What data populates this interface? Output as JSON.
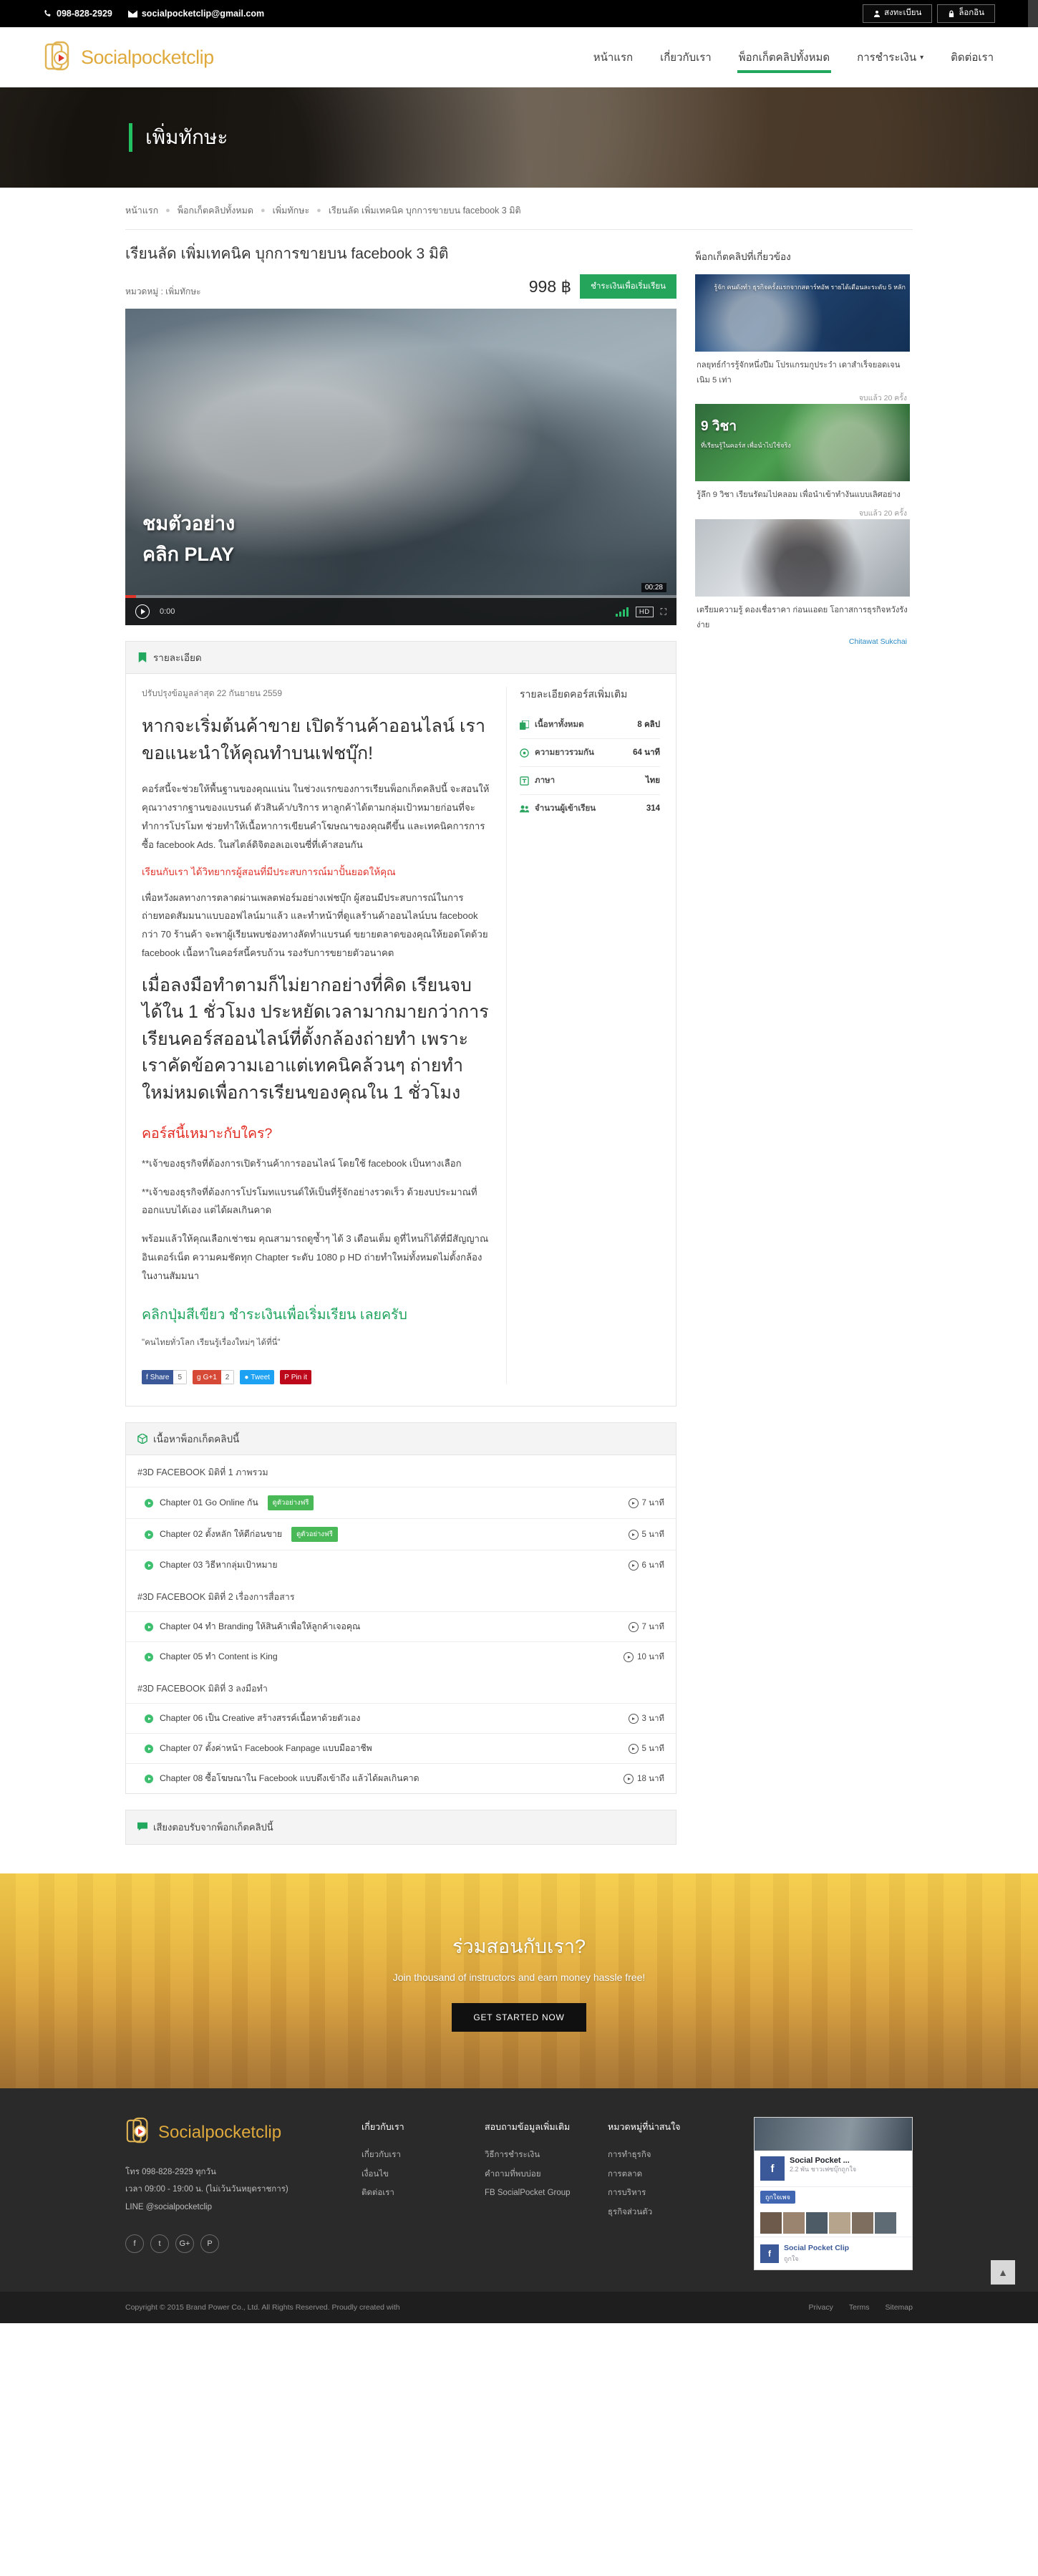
{
  "topbar": {
    "phone": "098-828-2929",
    "email": "socialpocketclip@gmail.com",
    "register_label": "สงทะเบียน",
    "login_label": "ล็อกอิน"
  },
  "brand": {
    "name": "Socialpocketclip",
    "color": "#dfa93c"
  },
  "nav": {
    "items": [
      {
        "label": "หน้าแรก",
        "active": false,
        "caret": false
      },
      {
        "label": "เกี่ยวกับเรา",
        "active": false,
        "caret": false
      },
      {
        "label": "พ็อกเก็ตคลิปทั้งหมด",
        "active": true,
        "caret": false
      },
      {
        "label": "การชำระเงิน",
        "active": false,
        "caret": true
      },
      {
        "label": "ติดต่อเรา",
        "active": false,
        "caret": false
      }
    ]
  },
  "hero": {
    "title": "เพิ่มทักษะ",
    "accent": "#22c061"
  },
  "breadcrumb": [
    "หน้าแรก",
    "พ็อกเก็ตคลิปทั้งหมด",
    "เพิ่มทักษะ",
    "เรียนลัด เพิ่มเทคนิค บุกการขายบน facebook 3 มิติ"
  ],
  "course": {
    "title": "เรียนลัด เพิ่มเทคนิค บุกการขายบน facebook 3 มิติ",
    "category_label": "หมวดหมู่ : เพิ่มทักษะ",
    "price": "998 ฿",
    "buy_label": "ชำระเงินเพื่อเริ่มเรียน"
  },
  "video": {
    "caption_line1": "ชมตัวอย่าง",
    "caption_line2": "คลิก PLAY",
    "time_bubble": "00:28",
    "current_time": "0:00",
    "hd_label": "HD"
  },
  "detail_panel": {
    "head": "รายละเอียด",
    "head_icon": "bookmark-icon",
    "updated": "ปรับปรุงข้อมูลล่าสุด 22 กันยายน 2559",
    "heading1": "หากจะเริ่มต้นค้าขาย เปิดร้านค้าออนไลน์ เราขอแนะนำให้คุณทำบนเฟชบุ๊ก!",
    "para1": "คอร์สนี้จะช่วยให้พื้นฐานของคุณแน่น  ในช่วงแรกของการเรียนพ็อกเก็ตคลิปนี้ จะสอนให้คุณวางรากฐานของแบรนด์ ตัวสินค้า/บริการ หาลูกค้าได้ตามกลุ่มเป้าหมายก่อนที่จะทำการโปรโมท ช่วยทำให้เนื้อหาการเขียนคำโฆษณาของคุณดีขึ้น และเทคนิคการการซื้อ facebook Ads. ในสไตล์ดิจิตอลเอเจนซี่ที่เค้าสอนกัน",
    "red_line": "เรียนกับเรา ได้วิทยากรผู้สอนที่มีประสบการณ์มาปั้นยอดให้คุณ",
    "para2": "เพื่อหวังผลทางการตลาดผ่านเพลตฟอร์มอย่างเฟชบุ๊ก ผู้สอนมีประสบการณ์ในการถ่ายทอดสัมมนาแบบออฟไลน์มาแล้ว  และทำหน้าที่ดูแลร้านค้าออนไลน์บน facebook กว่า 70 ร้านค้า จะพาผู้เรียนพบช่องทางลัดทำแบรนด์ ขยายตลาดของคุณให้ยอดโตด้วย facebook เนื้อหาในคอร์สนี้ครบถ้วน รองรับการขยายตัวอนาคต",
    "heading2": "เมื่อลงมือทำตามก็ไม่ยากอย่างที่คิด เรียนจบได้ใน 1 ชั่วโมง ประหยัดเวลามากมายกว่าการเรียนคอร์สออนไลน์ที่ตั้งกล้องถ่ายทำ เพราะเราคัดข้อความเอาแต่เทคนิคล้วนๆ ถ่ายทำใหม่หมดเพื่อการเรียนของคุณใน 1 ชั่วโมง",
    "who_heading": "คอร์สนี้เหมาะกับใคร?",
    "who1": "**เจ้าของธุรกิจที่ต้องการเปิดร้านค้าการออนไลน์ โดยใช้ facebook เป็นทางเลือก",
    "who2": "**เจ้าของธุรกิจที่ต้องการโปรโมทแบรนด์ให้เป็นที่รู้จักอย่างรวดเร็ว ด้วยงบประมาณที่ออกแบบได้เอง แต่ได้ผลเกินคาด",
    "who3": "พร้อมแล้วให้คุณเลือกเช่าชม  คุณสามารถดูซ้ำๆ ได้ 3 เดือนเต็ม ดูที่ไหนก็ได้ที่มีสัญญาณอินเตอร์เน็ต ความคมชัดทุก Chapter ระดับ 1080 p HD ถ่ายทำใหม่ทั้งหมดไม่ตั้งกล้องในงานสัมมนา",
    "green_heading": "คลิกปุ่มสีเขียว ชำระเงินเพื่อเริ่มเรียน เลยครับ",
    "quote": "\"คนไทยทั่วโลก เรียนรู้เรื่องใหม่ๆ ได้ที่นี่\""
  },
  "stats": {
    "title": "รายละเอียดคอร์สเพิ่มเติม",
    "rows": [
      {
        "icon": "clips-icon",
        "label": "เนื้อหาทั้งหมด",
        "value": "8 คลิป"
      },
      {
        "icon": "clock-icon",
        "label": "ความยาวรวมกัน",
        "value": "64 นาที"
      },
      {
        "icon": "language-icon",
        "label": "ภาษา",
        "value": "ไทย"
      },
      {
        "icon": "users-icon",
        "label": "จำนวนผู้เข้าเรียน",
        "value": "314"
      }
    ]
  },
  "share": [
    {
      "name": "facebook-share",
      "label": "Share",
      "count": "5"
    },
    {
      "name": "google-plus-share",
      "label": "G+1",
      "count": "2"
    },
    {
      "name": "twitter-share",
      "label": "Tweet",
      "count": ""
    },
    {
      "name": "pinterest-share",
      "label": "Pin it",
      "count": ""
    }
  ],
  "content_panel": {
    "head": "เนื้อหาพ็อกเก็ตคลิปนี้",
    "head_icon": "box-icon",
    "groups": [
      {
        "title": "#3D FACEBOOK มิติที่ 1 ภาพรวม",
        "chapters": [
          {
            "title": "Chapter 01 Go Online กัน",
            "free_tag": "ดูตัวอย่างฟรี",
            "duration": "7 นาที"
          },
          {
            "title": "Chapter 02 ตั้งหลัก ให้ดีก่อนขาย",
            "free_tag": "ดูตัวอย่างฟรี",
            "duration": "5 นาที"
          },
          {
            "title": "Chapter 03 วิธีหากลุ่มเป้าหมาย",
            "free_tag": "",
            "duration": "6 นาที"
          }
        ]
      },
      {
        "title": "#3D FACEBOOK มิติที่ 2 เรื่องการสื่อสาร",
        "chapters": [
          {
            "title": "Chapter 04 ทำ Branding ให้สินค้าเพื่อให้ลูกค้าเจอคุณ",
            "free_tag": "",
            "duration": "7 นาที"
          },
          {
            "title": "Chapter 05 ทำ Content is King",
            "free_tag": "",
            "duration": "10 นาที"
          }
        ]
      },
      {
        "title": "#3D FACEBOOK มิติที่ 3 ลงมือทำ",
        "chapters": [
          {
            "title": "Chapter 06 เป็น Creative สร้างสรรค์เนื้อหาด้วยตัวเอง",
            "free_tag": "",
            "duration": "3 นาที"
          },
          {
            "title": "Chapter 07 ตั้งค่าหน้า Facebook Fanpage แบบมืออาชีพ",
            "free_tag": "",
            "duration": "5 นาที"
          },
          {
            "title": "Chapter 08 ซื้อโฆษณาใน Facebook แบบดึงเข้าถึง แล้วได้ผลเกินคาด",
            "free_tag": "",
            "duration": "18 นาที"
          }
        ]
      }
    ]
  },
  "feedback_panel": {
    "head": "เสียงตอบรับจากพ็อกเก็ตคลิปนี้",
    "head_icon": "comment-icon"
  },
  "sidebar": {
    "title": "พ็อกเก็ตคลิปที่เกี่ยวข้อง",
    "cards": [
      {
        "thumb_big": "",
        "thumb_text": "รู้จัก คนดังทำ\nธุรกิจครั้งแรกจากสตาร์ทอัพ\nรายได้เดือนละระดับ 5 หลัก",
        "desc": "กลยุทธ์กำรรู้จักหนึ่งปีม โปรแกรมกูประวำ เดาสำเร็จยอดเจนเนิม 5 เท่า",
        "author": "จบแล้ว 20 ครั้ง",
        "author_link": false
      },
      {
        "thumb_big": "9 วิชา",
        "thumb_text": "ที่เรียนรู้ในคอร์ส\nเพื่อนำไปใช้จริง",
        "desc": "รู้ลึก 9 วิชา เรียนรัดมไปคลอม เพื่อนำเข้าทำงันแบบเลิศอย่าง",
        "author": "จบแล้ว 20 ครั้ง",
        "author_link": false
      },
      {
        "thumb_big": "",
        "thumb_text": "",
        "desc": "เตรียมความรู้ ดองเชื่อราคา ก่อนแอดย โอกาสการธุรกิจหวังรังง่าย",
        "author": "Chitawat Sukchai",
        "author_link": true
      }
    ]
  },
  "cta": {
    "heading": "ร่วมสอนกับเรา?",
    "subheading": "Join thousand of instructors and earn money hassle free!",
    "button": "GET STARTED NOW"
  },
  "footer": {
    "brand": "Socialpocketclip",
    "lines": [
      "โทร 098-828-2929 ทุกวัน",
      "เวลา 09:00 - 19:00 น. (ไม่เว้นวันหยุดราชการ)",
      "LINE @socialpocketclip"
    ],
    "columns": [
      {
        "title": "เกี่ยวกับเรา",
        "links": [
          "เกี่ยวกับเรา",
          "เงื่อนไข",
          "ติดต่อเรา"
        ]
      },
      {
        "title": "สอบถามข้อมูลเพิ่มเติม",
        "links": [
          "วิธีการชำระเงิน",
          "คำถามที่พบบ่อย",
          "FB SocialPocket Group"
        ]
      },
      {
        "title": "หมวดหมู่ที่น่าสนใจ",
        "links": [
          "การทำธุรกิจ",
          "การตลาด",
          "การบริหาร",
          "ธุรกิจส่วนตัว"
        ]
      }
    ],
    "social": [
      "facebook-icon",
      "twitter-icon",
      "google-plus-icon",
      "pinterest-icon"
    ],
    "fb_widget": {
      "page_name": "Social Pocket ...",
      "page_sub": "2.2 พัน ชาวเฟซบุ๊กถูกใจ",
      "like_label": "ถูกใจเพจ",
      "footer_title": "Social Pocket Clip",
      "footer_sub": "ถูกใจ"
    }
  },
  "copyright": {
    "text": "Copyright © 2015 Brand Power Co., Ltd. All Rights Reserved. Proudly created with",
    "links": [
      "Privacy",
      "Terms",
      "Sitemap"
    ]
  }
}
